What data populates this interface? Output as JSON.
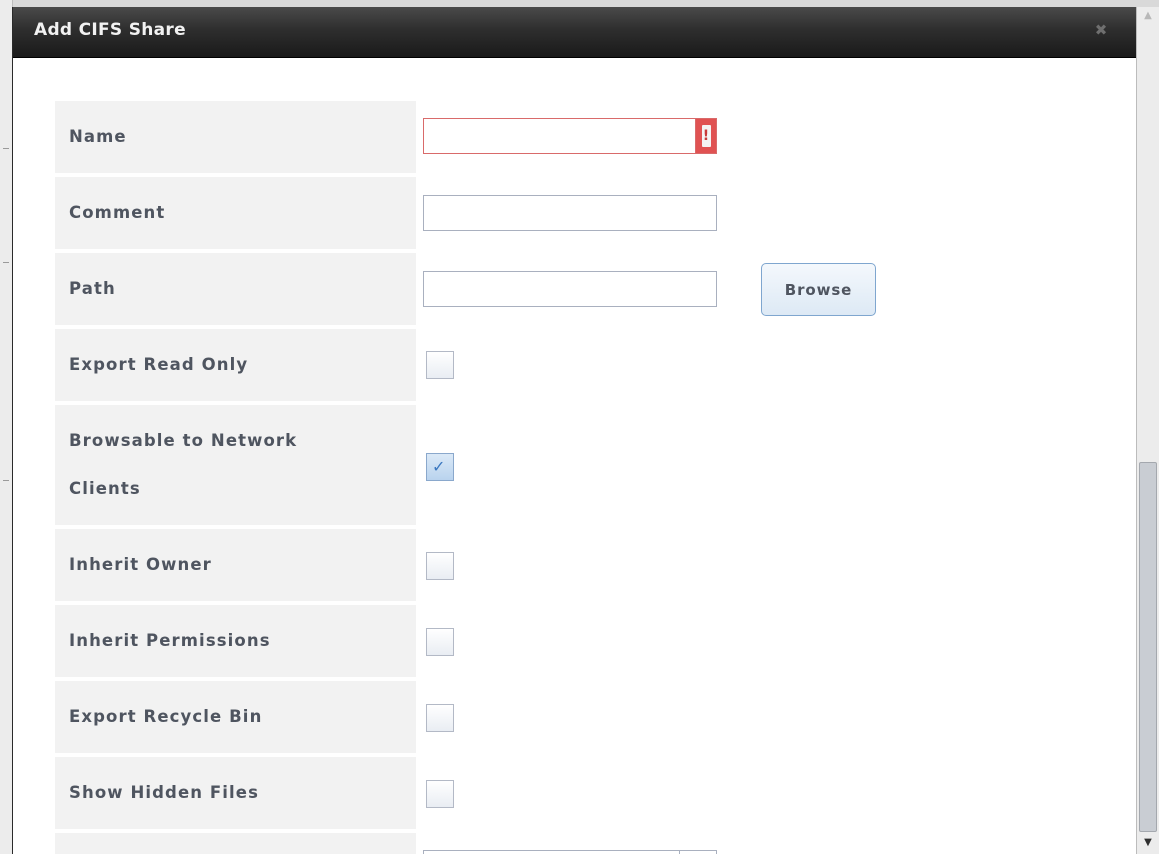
{
  "dialog": {
    "title": "Add CIFS Share",
    "close_icon": "close-icon"
  },
  "fields": {
    "name": {
      "label": "Name",
      "value": "",
      "error_icon": "!"
    },
    "comment": {
      "label": "Comment",
      "value": ""
    },
    "path": {
      "label": "Path",
      "value": "",
      "browse_label": "Browse"
    }
  },
  "checkboxes": [
    {
      "label": "Export Read Only",
      "checked": false
    },
    {
      "label": "Browsable to Network Clients",
      "checked": true
    },
    {
      "label": "Inherit Owner",
      "checked": false
    },
    {
      "label": "Inherit Permissions",
      "checked": false
    },
    {
      "label": "Export Recycle Bin",
      "checked": false
    },
    {
      "label": "Show Hidden Files",
      "checked": false
    }
  ],
  "colors": {
    "error": "#e05252",
    "label_bg": "#f2f2f2",
    "label_text": "#4f5560",
    "titlebar": "#2e2e2e"
  }
}
